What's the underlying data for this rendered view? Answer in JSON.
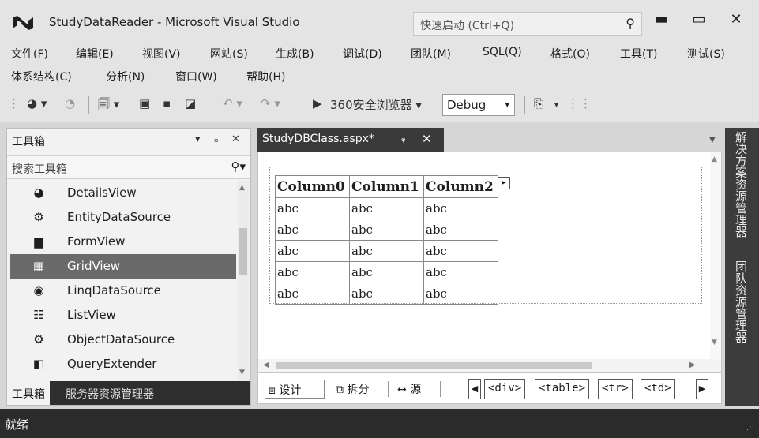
{
  "window": {
    "title": "StudyDataReader - Microsoft Visual Studio",
    "quick_launch_placeholder": "快速启动 (Ctrl+Q)"
  },
  "menu": {
    "items": [
      "文件(F)",
      "编辑(E)",
      "视图(V)",
      "网站(S)",
      "生成(B)",
      "调试(D)",
      "团队(M)",
      "SQL(Q)",
      "格式(O)",
      "工具(T)",
      "测试(S)",
      "体系结构(C)",
      "分析(N)",
      "窗口(W)",
      "帮助(H)"
    ]
  },
  "toolbar": {
    "run_target": "360安全浏览器",
    "configuration": "Debug"
  },
  "toolbox": {
    "title": "工具箱",
    "search_placeholder": "搜索工具箱",
    "selected": "GridView",
    "items": [
      {
        "label": "DetailsView",
        "icon": "details-view-icon",
        "glyph": "◕"
      },
      {
        "label": "EntityDataSource",
        "icon": "entity-datasource-icon",
        "glyph": "⚙"
      },
      {
        "label": "FormView",
        "icon": "form-view-icon",
        "glyph": "▆"
      },
      {
        "label": "GridView",
        "icon": "grid-view-icon",
        "glyph": "▦"
      },
      {
        "label": "LinqDataSource",
        "icon": "linq-datasource-icon",
        "glyph": "◉"
      },
      {
        "label": "ListView",
        "icon": "list-view-icon",
        "glyph": "☷"
      },
      {
        "label": "ObjectDataSource",
        "icon": "object-datasource-icon",
        "glyph": "⚙"
      },
      {
        "label": "QueryExtender",
        "icon": "query-extender-icon",
        "glyph": "◧"
      }
    ],
    "tabs": [
      "工具箱",
      "服务器资源管理器"
    ]
  },
  "document": {
    "tab_title": "StudyDBClass.aspx*",
    "grid": {
      "columns": [
        "Column0",
        "Column1",
        "Column2"
      ],
      "rows": [
        [
          "abc",
          "abc",
          "abc"
        ],
        [
          "abc",
          "abc",
          "abc"
        ],
        [
          "abc",
          "abc",
          "abc"
        ],
        [
          "abc",
          "abc",
          "abc"
        ],
        [
          "abc",
          "abc",
          "abc"
        ]
      ]
    },
    "view_tabs": [
      "设计",
      "拆分",
      "源"
    ],
    "breadcrumb_tags": [
      "<div>",
      "<table>",
      "<tr>",
      "<td>"
    ]
  },
  "side_panels": [
    "解决方案资源管理器",
    "团队资源管理器"
  ],
  "status": {
    "text": "就绪"
  }
}
